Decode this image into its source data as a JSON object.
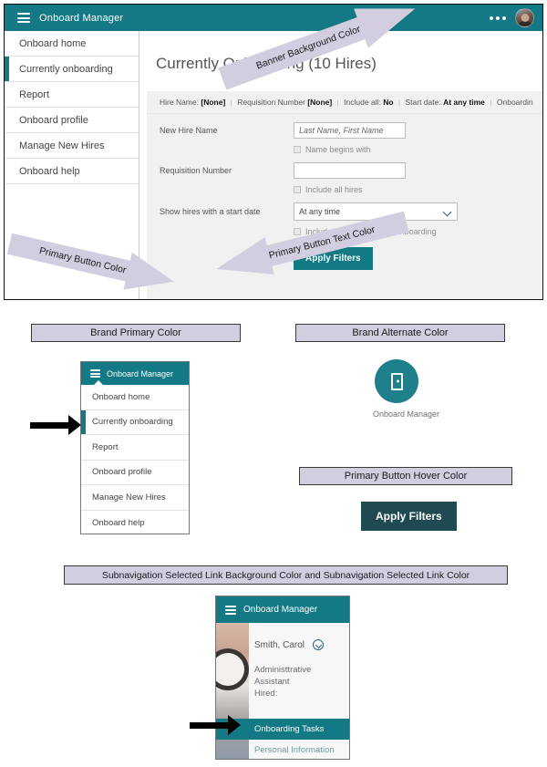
{
  "app_panel": {
    "banner": {
      "title": "Onboard Manager",
      "menu_icon": "hamburger-icon",
      "overflow_icon": "ellipsis-icon",
      "avatar_icon": "user-avatar",
      "background_color": "#137a85"
    },
    "sidebar": {
      "items": [
        {
          "label": "Onboard home",
          "selected": false
        },
        {
          "label": "Currently onboarding",
          "selected": true
        },
        {
          "label": "Report",
          "selected": false
        },
        {
          "label": "Onboard profile",
          "selected": false
        },
        {
          "label": "Manage New Hires",
          "selected": false
        },
        {
          "label": "Onboard help",
          "selected": false
        }
      ]
    },
    "heading": "Currently Onboarding (10 Hires)",
    "filter_summary": {
      "parts": [
        {
          "label": "Hire Name:",
          "value": "[None]"
        },
        {
          "label": "Requisition Number",
          "value": "[None]"
        },
        {
          "label": "Include all:",
          "value": "No"
        },
        {
          "label": "Start date:",
          "value": "At any time"
        },
        {
          "label": "Onboardin",
          "value": ""
        }
      ]
    },
    "form": {
      "new_hire_name_label": "New Hire Name",
      "new_hire_name_placeholder": "Last Name, First Name",
      "name_begins_with_label": "Name begins with",
      "requisition_number_label": "Requisition Number",
      "requisition_number_value": "",
      "include_all_hires_label": "Include all hires",
      "start_date_label": "Show hires with a start date",
      "start_date_value": "At any time",
      "include_ended_label": "Include hires that ended onboarding",
      "apply_button": "Apply Filters"
    }
  },
  "callouts": {
    "banner_background": "Banner Background Color",
    "primary_button_color": "Primary Button Color",
    "primary_button_text_color": "Primary Button Text Color",
    "brand_primary": "Brand Primary Color",
    "brand_alternate": "Brand Alternate Color",
    "primary_button_hover": "Primary Button Hover Color",
    "subnav_selected": "Subnavigation Selected Link Background Color and Subnavigation Selected Link Color"
  },
  "mini_nav": {
    "banner_title": "Onboard Manager",
    "items": [
      {
        "label": "Onboard home",
        "selected": false
      },
      {
        "label": "Currently onboarding",
        "selected": true
      },
      {
        "label": "Report",
        "selected": false
      },
      {
        "label": "Onboard profile",
        "selected": false
      },
      {
        "label": "Manage New Hires",
        "selected": false
      },
      {
        "label": "Onboard help",
        "selected": false
      }
    ]
  },
  "brand_logo": {
    "label": "Onboard Manager",
    "color": "#1f7f8b",
    "glyph": "badge-icon"
  },
  "hover_button": {
    "label": "Apply Filters",
    "color": "#1f4a52"
  },
  "subnav_panel": {
    "banner_title": "Onboard Manager",
    "person_name": "Smith,  Carol",
    "person_role": "Administtrative Assistant",
    "hired_label": "Hired:",
    "links": [
      {
        "label": "Onboarding Tasks",
        "selected": true
      },
      {
        "label": "Personal Information",
        "selected": false
      }
    ],
    "selected_background_color": "#137a85",
    "selected_text_color": "#ffffff"
  }
}
